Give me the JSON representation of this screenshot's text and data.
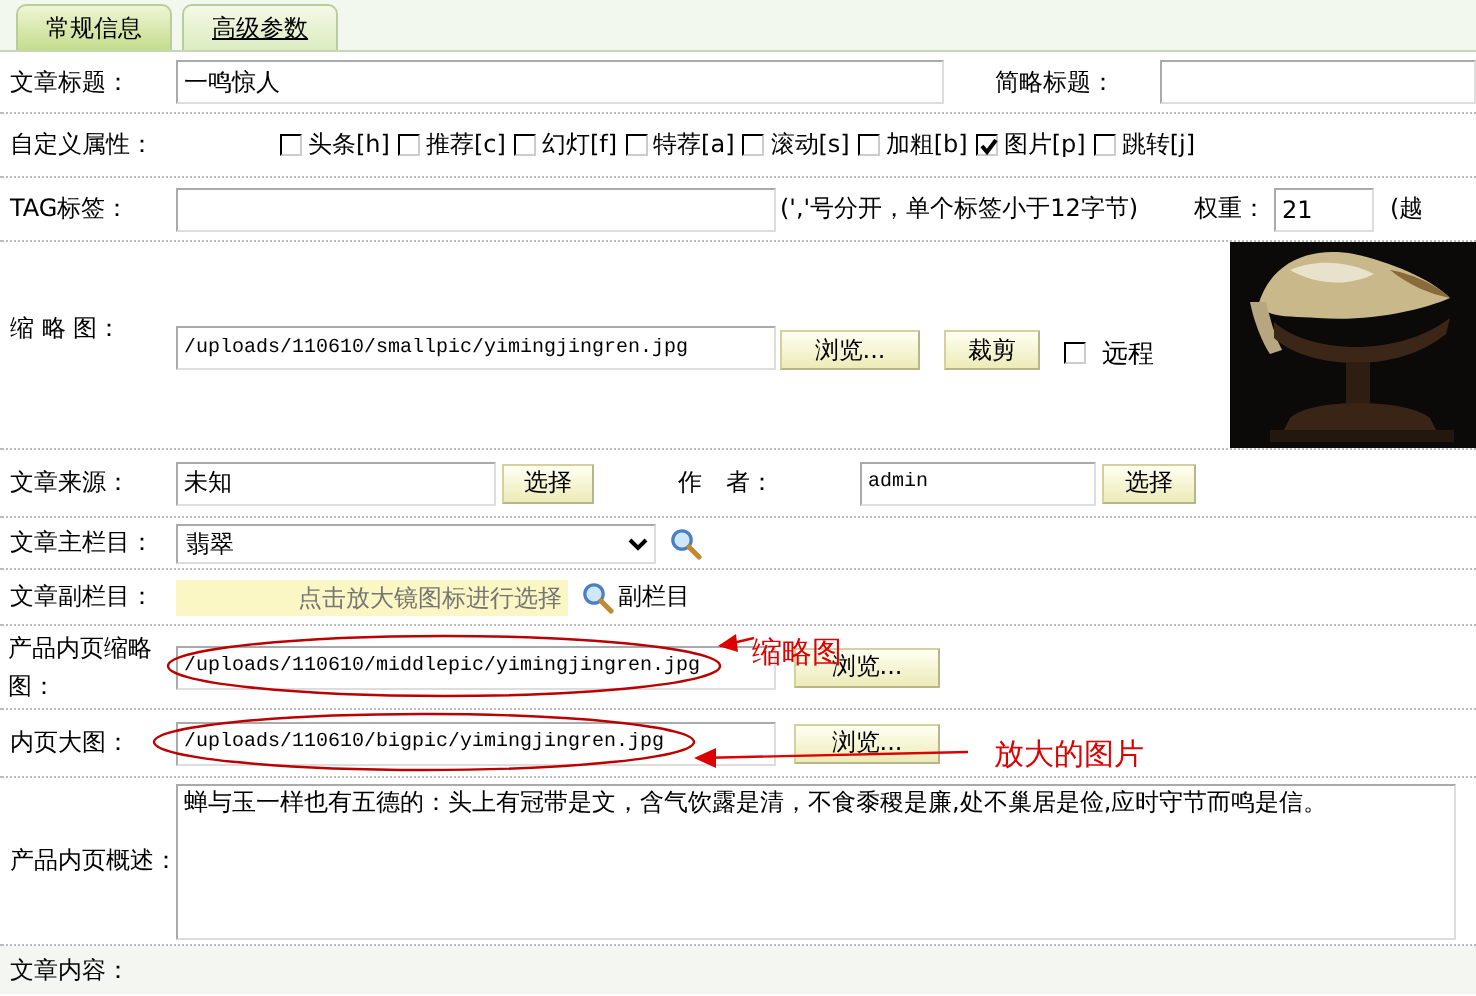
{
  "tabs": [
    {
      "label": "常规信息",
      "selected": true
    },
    {
      "label": "高级参数",
      "selected": false
    }
  ],
  "title": {
    "label": "文章标题：",
    "value": "一鸣惊人"
  },
  "short_title": {
    "label": "简略标题："
  },
  "attributes": {
    "label": "自定义属性：",
    "options": [
      {
        "label": "头条[h]",
        "checked": false
      },
      {
        "label": "推荐[c]",
        "checked": false
      },
      {
        "label": "幻灯[f]",
        "checked": false
      },
      {
        "label": "特荐[a]",
        "checked": false
      },
      {
        "label": "滚动[s]",
        "checked": false
      },
      {
        "label": "加粗[b]",
        "checked": false
      },
      {
        "label": "图片[p]",
        "checked": true
      },
      {
        "label": "跳转[j]",
        "checked": false
      }
    ]
  },
  "tags": {
    "label": "TAG标签：",
    "hint": "(','号分开，单个标签小于12字节)",
    "weight_label": "权重：",
    "weight": "21",
    "weight_hint": "(越"
  },
  "thumbnail": {
    "label": "缩 略 图：",
    "value": "/uploads/110610/smallpic/yimingjingren.jpg",
    "browse": "浏览...",
    "crop": "裁剪",
    "remote": {
      "label": "远程",
      "checked": false
    }
  },
  "source": {
    "label": "文章来源：",
    "value": "未知",
    "button": "选择"
  },
  "author": {
    "label": "作　者：",
    "value": "admin",
    "button": "选择"
  },
  "main_column": {
    "label": "文章主栏目：",
    "value": "翡翠"
  },
  "sub_column": {
    "label": "文章副栏目：",
    "placeholder": "点击放大镜图标进行选择",
    "link": "副栏目"
  },
  "inner_thumbnail": {
    "label": "产品内页缩略图：",
    "value": "/uploads/110610/middlepic/yimingjingren.jpg",
    "browse": "浏览..."
  },
  "inner_image": {
    "label": "内页大图：",
    "value": "/uploads/110610/bigpic/yimingjingren.jpg",
    "browse": "浏览..."
  },
  "summary": {
    "label": "产品内页概述：",
    "value": "蝉与玉一样也有五德的：头上有冠带是文，含气饮露是清，不食黍稷是廉,处不巢居是俭,应时守节而鸣是信。"
  },
  "content": {
    "label": "文章内容："
  },
  "annotations": [
    {
      "text": "缩略图"
    },
    {
      "text": "放大的图片"
    }
  ]
}
